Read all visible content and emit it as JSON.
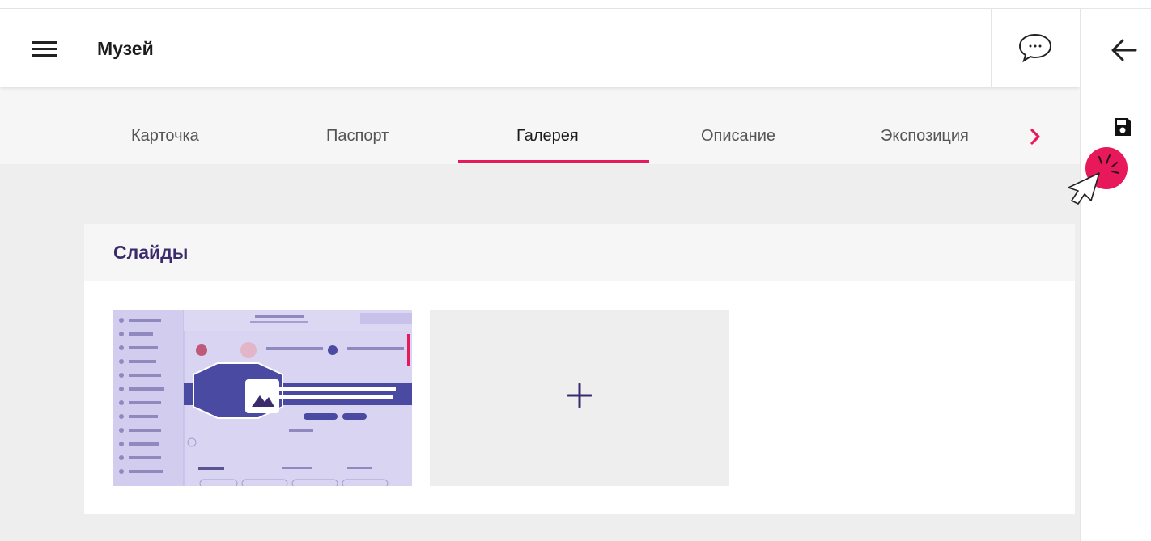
{
  "header": {
    "title": "Музей",
    "menu_icon": "hamburger-menu-icon",
    "chat_icon": "chat-bubble-icon",
    "back_icon": "arrow-left-icon"
  },
  "toolbar": {
    "save_icon": "floppy-disk-icon"
  },
  "tabs": [
    {
      "label": "Карточка",
      "active": false
    },
    {
      "label": "Паспорт",
      "active": false
    },
    {
      "label": "Галерея",
      "active": true
    },
    {
      "label": "Описание",
      "active": false
    },
    {
      "label": "Экспозиция",
      "active": false
    }
  ],
  "tabs_next_icon": "chevron-right-icon",
  "slides": {
    "title": "Слайды",
    "items": [
      {
        "type": "image",
        "icon": "image-mountain-icon"
      }
    ],
    "add_icon": "plus-icon"
  },
  "colors": {
    "accent": "#e8195a",
    "title_purple": "#3b2b6d",
    "content_bg": "#eeeeee",
    "thumbnail_bg": "#d8d4f2",
    "thumbnail_banner": "#4a4aa3"
  }
}
